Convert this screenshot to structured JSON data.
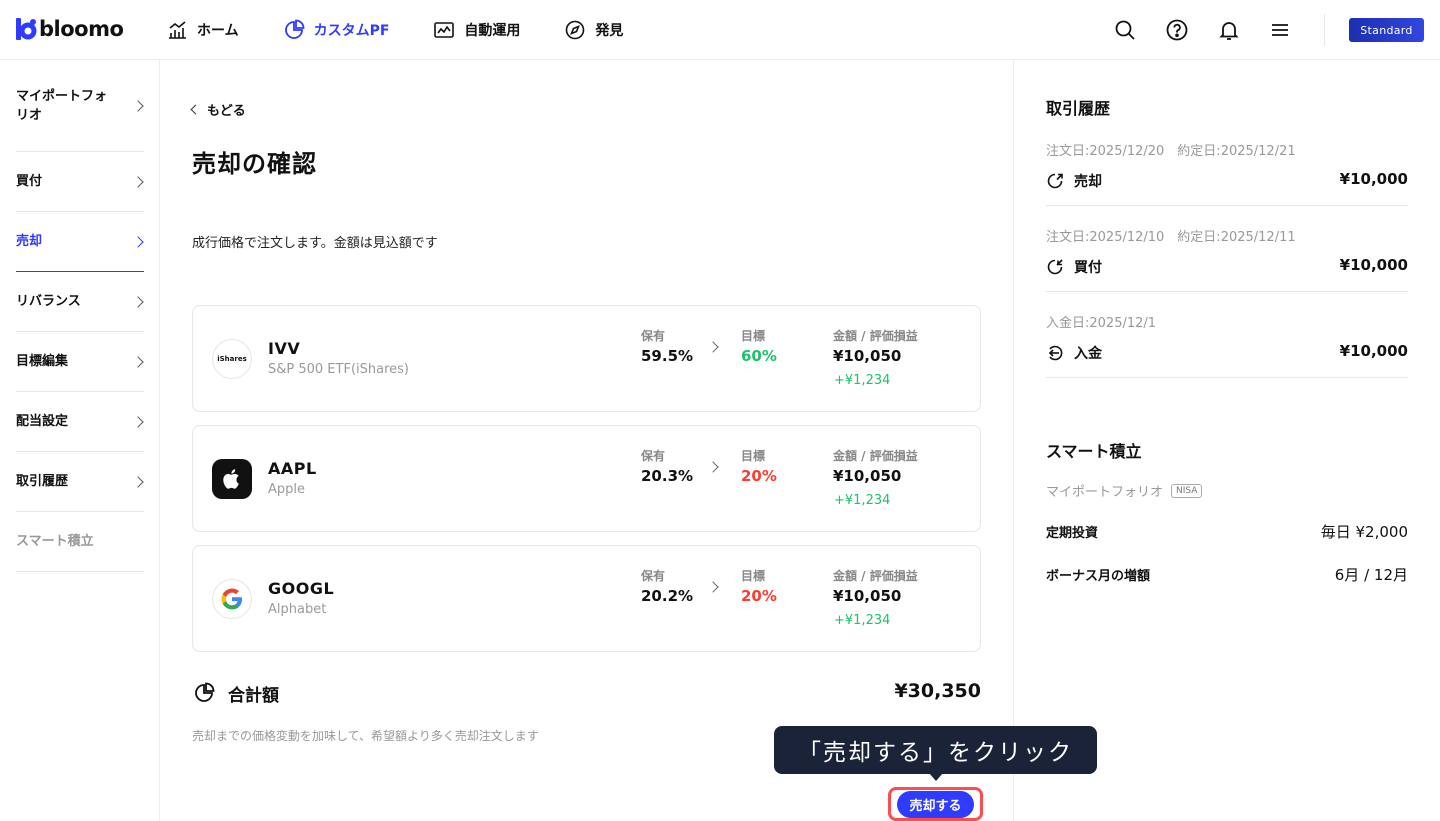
{
  "brand": {
    "name": "bloomo",
    "accent": "#2f3bff",
    "plan": "Standard"
  },
  "nav": [
    {
      "label": "ホーム",
      "icon": "chart-bars-icon",
      "active": false
    },
    {
      "label": "カスタムPF",
      "icon": "pie-chart-icon",
      "active": true
    },
    {
      "label": "自動運用",
      "icon": "trend-chart-icon",
      "active": false
    },
    {
      "label": "発見",
      "icon": "compass-icon",
      "active": false
    }
  ],
  "sidebar": {
    "items": [
      {
        "label": "マイポートフォリオ"
      },
      {
        "label": "買付"
      },
      {
        "label": "売却"
      },
      {
        "label": "リバランス"
      },
      {
        "label": "目標編集"
      },
      {
        "label": "配当設定"
      },
      {
        "label": "取引履歴"
      },
      {
        "label": "スマート積立"
      }
    ]
  },
  "main": {
    "back_label": "もどる",
    "title": "売却の確認",
    "description": "成行価格で注文します。金額は見込額です",
    "col_holding": "保有",
    "col_target": "目標",
    "col_amount": "金額 / 評価損益",
    "holdings": [
      {
        "ticker": "IVV",
        "name": "S&P 500 ETF(iShares)",
        "logo_text": "iShares",
        "holding": "59.5%",
        "target": "60%",
        "target_status": "green",
        "amount": "¥10,050",
        "pnl": "+¥1,234"
      },
      {
        "ticker": "AAPL",
        "name": "Apple",
        "logo_text": "",
        "holding": "20.3%",
        "target": "20%",
        "target_status": "red",
        "amount": "¥10,050",
        "pnl": "+¥1,234"
      },
      {
        "ticker": "GOOGL",
        "name": "Alphabet",
        "logo_text": "G",
        "holding": "20.2%",
        "target": "20%",
        "target_status": "red",
        "amount": "¥10,050",
        "pnl": "+¥1,234"
      }
    ],
    "total_label": "合計額",
    "total_value": "¥30,350",
    "note": "売却までの価格変動を加味して、希望額より多く売却注文します",
    "tooltip": "「売却する」をクリック",
    "sell_button": "売却する"
  },
  "history": {
    "title": "取引履歴",
    "items": [
      {
        "date": "注文日:2025/12/20　約定日:2025/12/21",
        "kind": "売却",
        "amount": "¥10,000",
        "icon": "sell-icon"
      },
      {
        "date": "注文日:2025/12/10　約定日:2025/12/11",
        "kind": "買付",
        "amount": "¥10,000",
        "icon": "buy-icon"
      },
      {
        "date": "入金日:2025/12/1",
        "kind": "入金",
        "amount": "¥10,000",
        "icon": "deposit-icon"
      }
    ]
  },
  "smart": {
    "title": "スマート積立",
    "portfolio": "マイポートフォリオ",
    "badge": "NISA",
    "rows": [
      {
        "label": "定期投資",
        "value": "毎日 ¥2,000"
      },
      {
        "label": "ボーナス月の増額",
        "value": "6月 / 12月"
      }
    ]
  }
}
